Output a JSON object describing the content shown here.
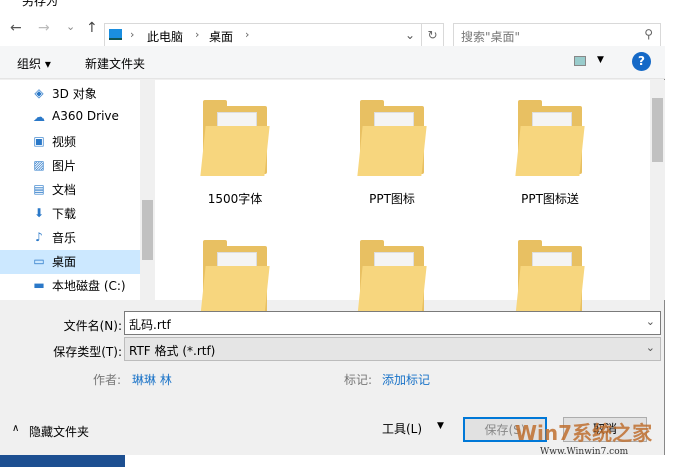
{
  "window": {
    "title": "另存为"
  },
  "nav": {
    "back": "←",
    "forward": "→",
    "recent": "⌄",
    "up": "↑",
    "path": [
      "此电脑",
      "桌面"
    ],
    "search_placeholder": "搜索\"桌面\""
  },
  "toolbar": {
    "organize": "组织 ▾",
    "new_folder": "新建文件夹",
    "help": "?"
  },
  "sidebar": {
    "items": [
      {
        "label": "3D 对象",
        "icon": "cube-icon",
        "glyph": "◈"
      },
      {
        "label": "A360 Drive",
        "icon": "cloud-drive-icon",
        "glyph": "☁"
      },
      {
        "label": "视频",
        "icon": "video-icon",
        "glyph": "▣"
      },
      {
        "label": "图片",
        "icon": "picture-icon",
        "glyph": "▨"
      },
      {
        "label": "文档",
        "icon": "document-icon",
        "glyph": "▤"
      },
      {
        "label": "下载",
        "icon": "download-icon",
        "glyph": "⬇"
      },
      {
        "label": "音乐",
        "icon": "music-icon",
        "glyph": "♪"
      },
      {
        "label": "桌面",
        "icon": "desktop-icon",
        "glyph": "▭"
      },
      {
        "label": "本地磁盘 (C:)",
        "icon": "disk-icon",
        "glyph": "▬"
      }
    ]
  },
  "files": [
    {
      "name": "1500字体"
    },
    {
      "name": "PPT图标"
    },
    {
      "name": "PPT图标送"
    },
    {
      "name": ""
    },
    {
      "name": ""
    },
    {
      "name": ""
    }
  ],
  "form": {
    "filename_label": "文件名(N):",
    "filename": "乱码.rtf",
    "type_label": "保存类型(T):",
    "type": "RTF 格式 (*.rtf)",
    "author_label": "作者:",
    "author": "琳琳 林",
    "tags_label": "标记:",
    "tags": "添加标记"
  },
  "footer": {
    "hide_folders": "隐藏文件夹",
    "tools": "工具(L)",
    "save": "保存(S)",
    "cancel": "取消"
  },
  "watermark": {
    "text": "Win7系统之家",
    "url": "Www.Winwin7.com"
  }
}
